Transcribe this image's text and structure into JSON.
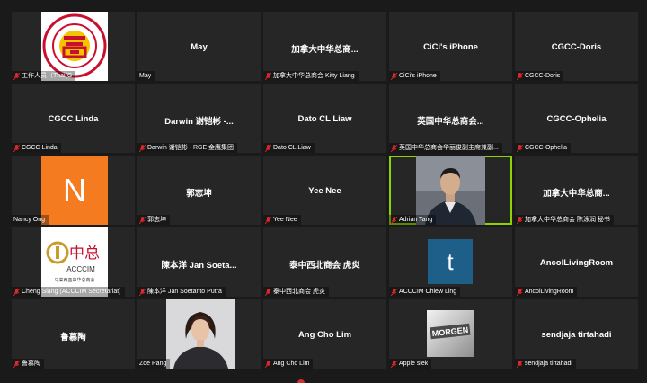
{
  "tiles": [
    {
      "row": 1,
      "col": 1,
      "label": "工作人员（Thai(G",
      "type": "logo-circle"
    },
    {
      "row": 1,
      "col": 2,
      "center": "May",
      "label": "May"
    },
    {
      "row": 1,
      "col": 3,
      "center": "加拿大中华总商...",
      "label": "加拿大中华总商会 Kitty Liang"
    },
    {
      "row": 1,
      "col": 4,
      "center": "CiCi's iPhone",
      "label": "CiCi's iPhone"
    },
    {
      "row": 1,
      "col": 5,
      "center": "CGCC-Doris",
      "label": "CGCC-Doris"
    },
    {
      "row": 2,
      "col": 1,
      "center": "CGCC Linda",
      "label": "CGCC Linda"
    },
    {
      "row": 2,
      "col": 2,
      "center": "Darwin 谢铠彬 -...",
      "label": "Darwin 谢铠彬 - RGE 金鹰集团"
    },
    {
      "row": 2,
      "col": 3,
      "center": "Dato CL Liaw",
      "label": "Dato CL Liaw"
    },
    {
      "row": 2,
      "col": 4,
      "center": "英国中华总商会...",
      "label": "英国中华总商会华丽俊副主席兼副..."
    },
    {
      "row": 2,
      "col": 5,
      "center": "CGCC-Ophelia",
      "label": "CGCC-Ophelia"
    },
    {
      "row": 3,
      "col": 1,
      "label": "Nancy Ong",
      "type": "avatar-n",
      "avatar": "N"
    },
    {
      "row": 3,
      "col": 2,
      "center": "郭志坤",
      "label": "郭志坤"
    },
    {
      "row": 3,
      "col": 3,
      "center": "Yee Nee",
      "label": "Yee Nee"
    },
    {
      "row": 3,
      "col": 4,
      "label": "Adrian Tang",
      "type": "photo-man",
      "active": true
    },
    {
      "row": 3,
      "col": 5,
      "center": "加拿大中华总商...",
      "label": "加拿大中华总商会 陈泳润 秘书"
    },
    {
      "row": 4,
      "col": 1,
      "label": "Cheng Siang (ACCCIM Secretariat)",
      "type": "logo-acccim",
      "logo_cn": "中总",
      "logo_en": "ACCCIM",
      "logo_sub": "马来西亚中华总商会"
    },
    {
      "row": 4,
      "col": 2,
      "center": "陳本洋 Jan Soeta...",
      "label": "陳本洋 Jan Soetanto Putra"
    },
    {
      "row": 4,
      "col": 3,
      "center": "泰中西北商会 虎炎",
      "label": "泰中西北商会 虎炎"
    },
    {
      "row": 4,
      "col": 4,
      "label": "ACCCIM Chiew Ling",
      "type": "avatar-t",
      "avatar": "t"
    },
    {
      "row": 4,
      "col": 5,
      "center": "AncolLivingRoom",
      "label": "AncolLivingRoom"
    },
    {
      "row": 5,
      "col": 1,
      "center": "鲁慕陶",
      "label": "鲁慕陶"
    },
    {
      "row": 5,
      "col": 2,
      "label": "Zoe Pang",
      "type": "photo-woman"
    },
    {
      "row": 5,
      "col": 3,
      "center": "Ang Cho Lim",
      "label": "Ang Cho Lim"
    },
    {
      "row": 5,
      "col": 4,
      "label": "Apple siek",
      "type": "photo-morgen",
      "sign_text": "MORGEN"
    },
    {
      "row": 5,
      "col": 5,
      "center": "sendjaja tirtahadi",
      "label": "sendjaja tirtahadi"
    }
  ],
  "colors": {
    "background": "#1a1a1a",
    "tile": "#262626",
    "active_border": "#8bd400",
    "muted_mic": "#e02828",
    "avatar_n": "#f47b20",
    "avatar_t": "#1e5f8a"
  },
  "icons": {
    "tile_label": "muted-mic-icon"
  }
}
